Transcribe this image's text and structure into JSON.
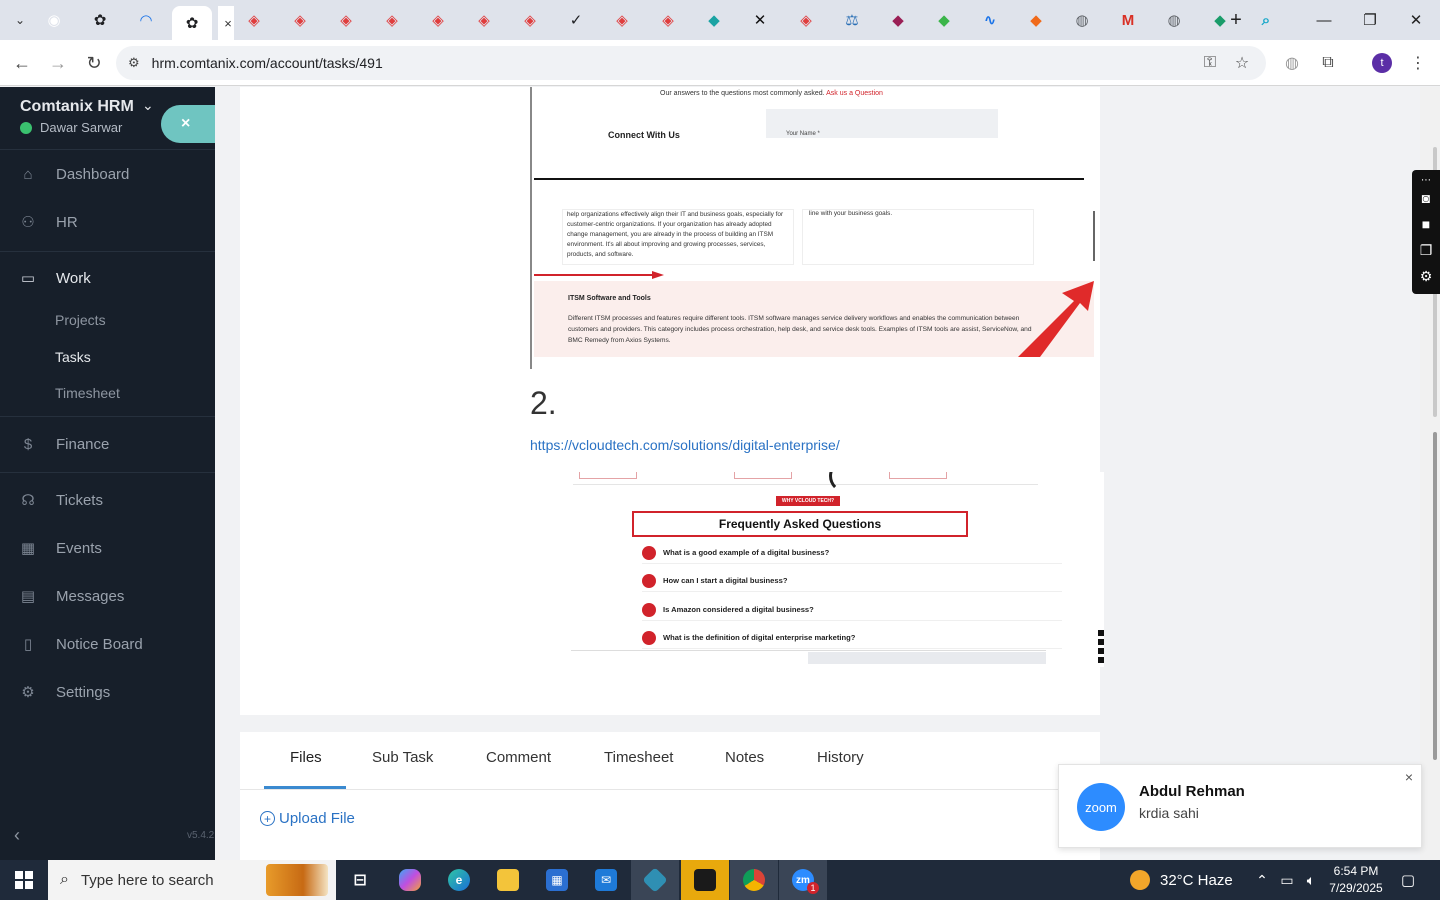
{
  "browser": {
    "tabs": [
      {
        "icon": "chrome-icon",
        "color": "#ffffff"
      },
      {
        "icon": "openai-icon",
        "color": "#202124"
      },
      {
        "icon": "wifi-arc-icon",
        "color": "#1a73e8"
      },
      {
        "icon": "openai-icon",
        "color": "#202124"
      },
      {
        "icon": "hrm-icon",
        "color": "#e03d3d"
      },
      {
        "icon": "hrm-icon",
        "color": "#e03d3d"
      },
      {
        "icon": "hrm-icon",
        "color": "#e03d3d"
      },
      {
        "icon": "hrm-icon",
        "color": "#e03d3d"
      },
      {
        "icon": "hrm-icon",
        "color": "#e03d3d"
      },
      {
        "icon": "hrm-icon",
        "color": "#e03d3d"
      },
      {
        "icon": "hrm-icon",
        "color": "#e03d3d"
      },
      {
        "icon": "check-icon",
        "color": "#202124"
      },
      {
        "icon": "hrm-icon",
        "color": "#e03d3d"
      },
      {
        "icon": "hrm-icon",
        "color": "#e03d3d"
      },
      {
        "icon": "app-icon",
        "color": "#1aa3a3"
      },
      {
        "icon": "x-icon",
        "color": "#111111"
      },
      {
        "icon": "hrm-icon",
        "color": "#e03d3d"
      },
      {
        "icon": "scale-icon",
        "color": "#2a6fb5"
      },
      {
        "icon": "app-icon",
        "color": "#9a1f55"
      },
      {
        "icon": "app-icon",
        "color": "#3bb54a"
      },
      {
        "icon": "pulse-icon",
        "color": "#1a73e8"
      },
      {
        "icon": "app-icon",
        "color": "#f06a1a"
      },
      {
        "icon": "globe-icon",
        "color": "#5f6368"
      },
      {
        "icon": "gmail-icon",
        "color": "#d93025"
      },
      {
        "icon": "globe-icon",
        "color": "#5f6368"
      },
      {
        "icon": "app-icon",
        "color": "#1a9c6a"
      },
      {
        "icon": "search-icon",
        "color": "#19a8c9"
      }
    ],
    "active_tab_close": "×",
    "new_tab": "+",
    "url": "hrm.comtanix.com/account/tasks/491",
    "profile_initial": "t"
  },
  "sidebar": {
    "brand": "Comtanix HRM",
    "user": "Dawar Sarwar",
    "collapse_glyph": "×",
    "items": {
      "dashboard": "Dashboard",
      "hr": "HR",
      "work": "Work",
      "projects": "Projects",
      "tasks": "Tasks",
      "timesheet": "Timesheet",
      "finance": "Finance",
      "tickets": "Tickets",
      "events": "Events",
      "messages": "Messages",
      "notice_board": "Notice Board",
      "settings": "Settings"
    },
    "version": "v5.4.2"
  },
  "content": {
    "shot1": {
      "caption": "Our answers to the questions most commonly asked.",
      "caption_link": "Ask us a Question",
      "connect_title": "Connect With Us",
      "name_label": "Your Name *",
      "card_a": "help organizations effectively align their IT and business goals, especially for customer-centric organizations. If your organization has already adopted change management, you are already in the process of building an ITSM environment. It's all about improving and growing processes, services, products, and software.",
      "card_b": "line with your business goals.",
      "itsm_title": "ITSM Software and Tools",
      "itsm_body": "Different ITSM processes and features require different tools. ITSM software manages service delivery workflows and enables the communication between customers and providers. This category includes process orchestration, help desk, and service desk tools. Examples of ITSM tools are assist, ServiceNow, and BMC Remedy from Axios Systems."
    },
    "step_number": "2.",
    "step_link": "https://vcloudtech.com/solutions/digital-enterprise/",
    "shot2": {
      "badge": "WHY VCLOUD TECH?",
      "faq_title": "Frequently Asked Questions",
      "questions": [
        "What is a good example of a digital business?",
        "How can I start a digital business?",
        "Is Amazon considered a digital business?",
        "What is the definition of digital enterprise marketing?"
      ]
    }
  },
  "task_tabs": {
    "files": "Files",
    "sub_task": "Sub Task",
    "comment": "Comment",
    "timesheet": "Timesheet",
    "notes": "Notes",
    "history": "History",
    "active": "Files"
  },
  "upload": {
    "label": "Upload File"
  },
  "zoom": {
    "logo": "zoom",
    "sender": "Abdul Rehman",
    "message": "krdia sahi",
    "close": "×"
  },
  "taskbar": {
    "search_placeholder": "Type here to search",
    "weather": "32°C  Haze",
    "time": "6:54 PM",
    "date": "7/29/2025",
    "zoom_badge": "1"
  }
}
